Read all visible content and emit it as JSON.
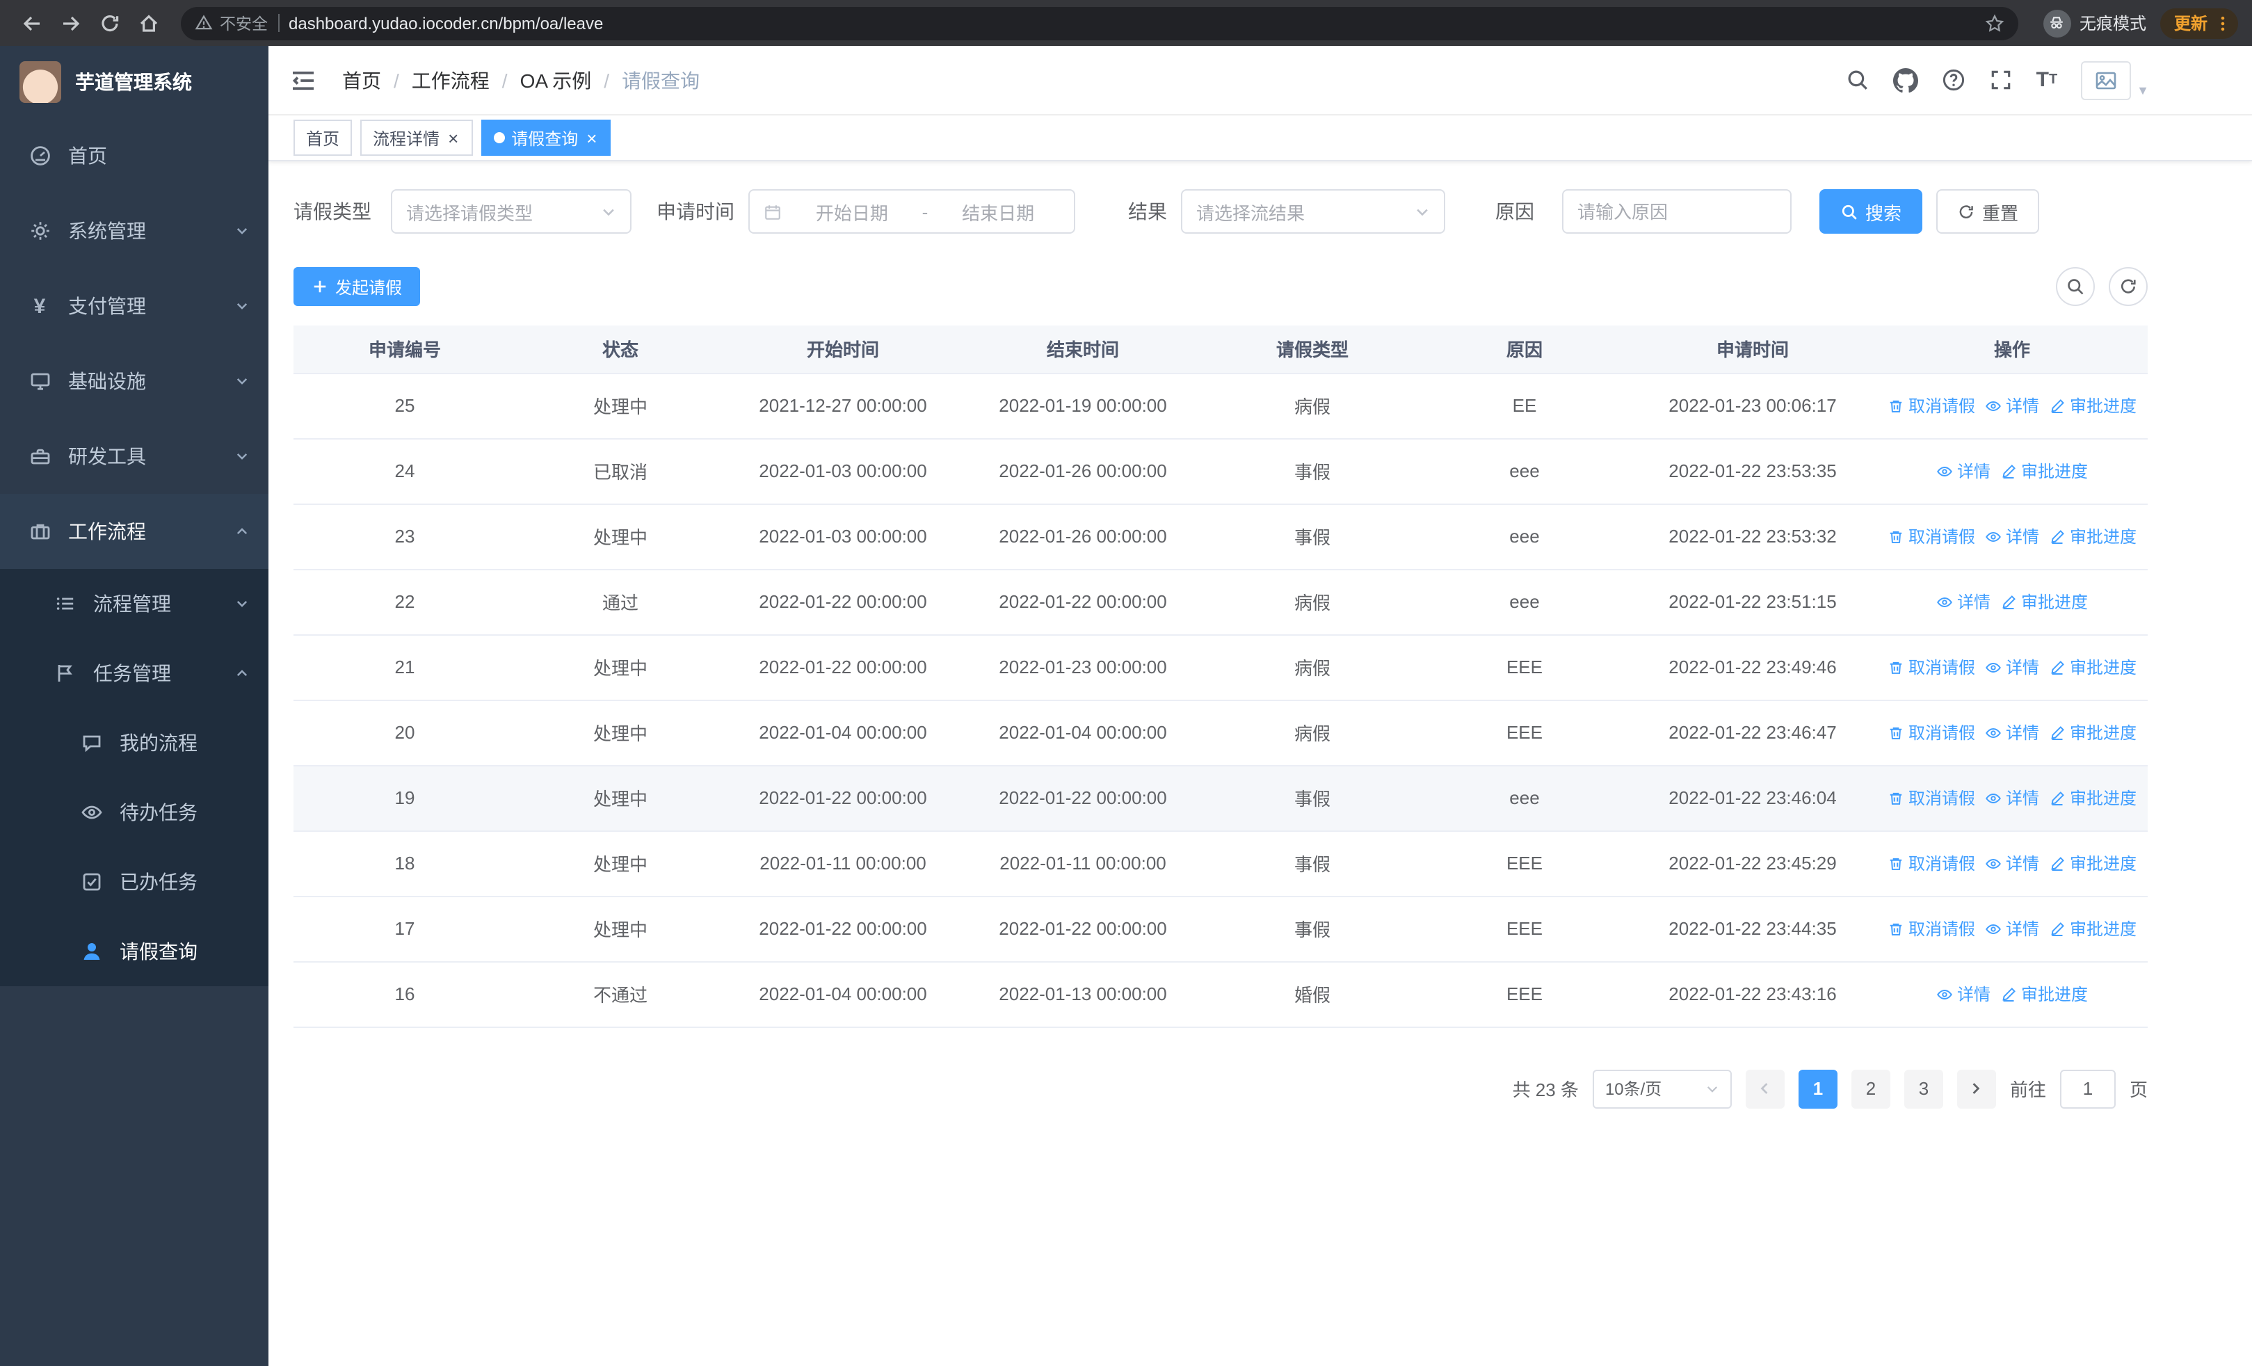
{
  "theme": {
    "accent": "#409eff",
    "sidebar_bg": "#2d3a4b",
    "submenu_bg": "#1f2d3d",
    "chrome_bg": "#35363a"
  },
  "browser": {
    "security_label": "不安全",
    "url": "dashboard.yudao.iocoder.cn/bpm/oa/leave",
    "incognito_label": "无痕模式",
    "update_label": "更新"
  },
  "sidebar": {
    "app_title": "芋道管理系统",
    "menu": {
      "home": "首页",
      "system": "系统管理",
      "payment": "支付管理",
      "infra": "基础设施",
      "devtools": "研发工具",
      "workflow": "工作流程",
      "process_mgmt": "流程管理",
      "task_mgmt": "任务管理",
      "my_process": "我的流程",
      "todo_tasks": "待办任务",
      "done_tasks": "已办任务",
      "leave_query": "请假查询"
    }
  },
  "header": {
    "breadcrumb": [
      "首页",
      "工作流程",
      "OA 示例",
      "请假查询"
    ]
  },
  "tabs": [
    {
      "label": "首页"
    },
    {
      "label": "流程详情"
    },
    {
      "label": "请假查询"
    }
  ],
  "filters": {
    "leave_type_label": "请假类型",
    "leave_type_placeholder": "请选择请假类型",
    "apply_time_label": "申请时间",
    "start_date_placeholder": "开始日期",
    "date_separator": "-",
    "end_date_placeholder": "结束日期",
    "result_label": "结果",
    "result_placeholder": "请选择流结果",
    "reason_label": "原因",
    "reason_placeholder": "请输入原因",
    "search_label": "搜索",
    "reset_label": "重置"
  },
  "toolbar": {
    "create_label": "发起请假"
  },
  "table": {
    "columns": [
      "申请编号",
      "状态",
      "开始时间",
      "结束时间",
      "请假类型",
      "原因",
      "申请时间",
      "操作"
    ],
    "actions": {
      "cancel": "取消请假",
      "detail": "详情",
      "progress": "审批进度"
    },
    "rows": [
      {
        "id": "25",
        "status": "处理中",
        "start": "2021-12-27 00:00:00",
        "end": "2022-01-19 00:00:00",
        "type": "病假",
        "reason": "EE",
        "applied": "2022-01-23 00:06:17",
        "can_cancel": true,
        "highlight": false
      },
      {
        "id": "24",
        "status": "已取消",
        "start": "2022-01-03 00:00:00",
        "end": "2022-01-26 00:00:00",
        "type": "事假",
        "reason": "eee",
        "applied": "2022-01-22 23:53:35",
        "can_cancel": false,
        "highlight": false
      },
      {
        "id": "23",
        "status": "处理中",
        "start": "2022-01-03 00:00:00",
        "end": "2022-01-26 00:00:00",
        "type": "事假",
        "reason": "eee",
        "applied": "2022-01-22 23:53:32",
        "can_cancel": true,
        "highlight": false
      },
      {
        "id": "22",
        "status": "通过",
        "start": "2022-01-22 00:00:00",
        "end": "2022-01-22 00:00:00",
        "type": "病假",
        "reason": "eee",
        "applied": "2022-01-22 23:51:15",
        "can_cancel": false,
        "highlight": false
      },
      {
        "id": "21",
        "status": "处理中",
        "start": "2022-01-22 00:00:00",
        "end": "2022-01-23 00:00:00",
        "type": "病假",
        "reason": "EEE",
        "applied": "2022-01-22 23:49:46",
        "can_cancel": true,
        "highlight": false
      },
      {
        "id": "20",
        "status": "处理中",
        "start": "2022-01-04 00:00:00",
        "end": "2022-01-04 00:00:00",
        "type": "病假",
        "reason": "EEE",
        "applied": "2022-01-22 23:46:47",
        "can_cancel": true,
        "highlight": false
      },
      {
        "id": "19",
        "status": "处理中",
        "start": "2022-01-22 00:00:00",
        "end": "2022-01-22 00:00:00",
        "type": "事假",
        "reason": "eee",
        "applied": "2022-01-22 23:46:04",
        "can_cancel": true,
        "highlight": true
      },
      {
        "id": "18",
        "status": "处理中",
        "start": "2022-01-11 00:00:00",
        "end": "2022-01-11 00:00:00",
        "type": "事假",
        "reason": "EEE",
        "applied": "2022-01-22 23:45:29",
        "can_cancel": true,
        "highlight": false
      },
      {
        "id": "17",
        "status": "处理中",
        "start": "2022-01-22 00:00:00",
        "end": "2022-01-22 00:00:00",
        "type": "事假",
        "reason": "EEE",
        "applied": "2022-01-22 23:44:35",
        "can_cancel": true,
        "highlight": false
      },
      {
        "id": "16",
        "status": "不通过",
        "start": "2022-01-04 00:00:00",
        "end": "2022-01-13 00:00:00",
        "type": "婚假",
        "reason": "EEE",
        "applied": "2022-01-22 23:43:16",
        "can_cancel": false,
        "highlight": false
      }
    ]
  },
  "pagination": {
    "total": "共 23 条",
    "page_size": "10条/页",
    "pages": [
      "1",
      "2",
      "3"
    ],
    "goto_label": "前往",
    "goto_value": "1",
    "goto_suffix": "页"
  }
}
